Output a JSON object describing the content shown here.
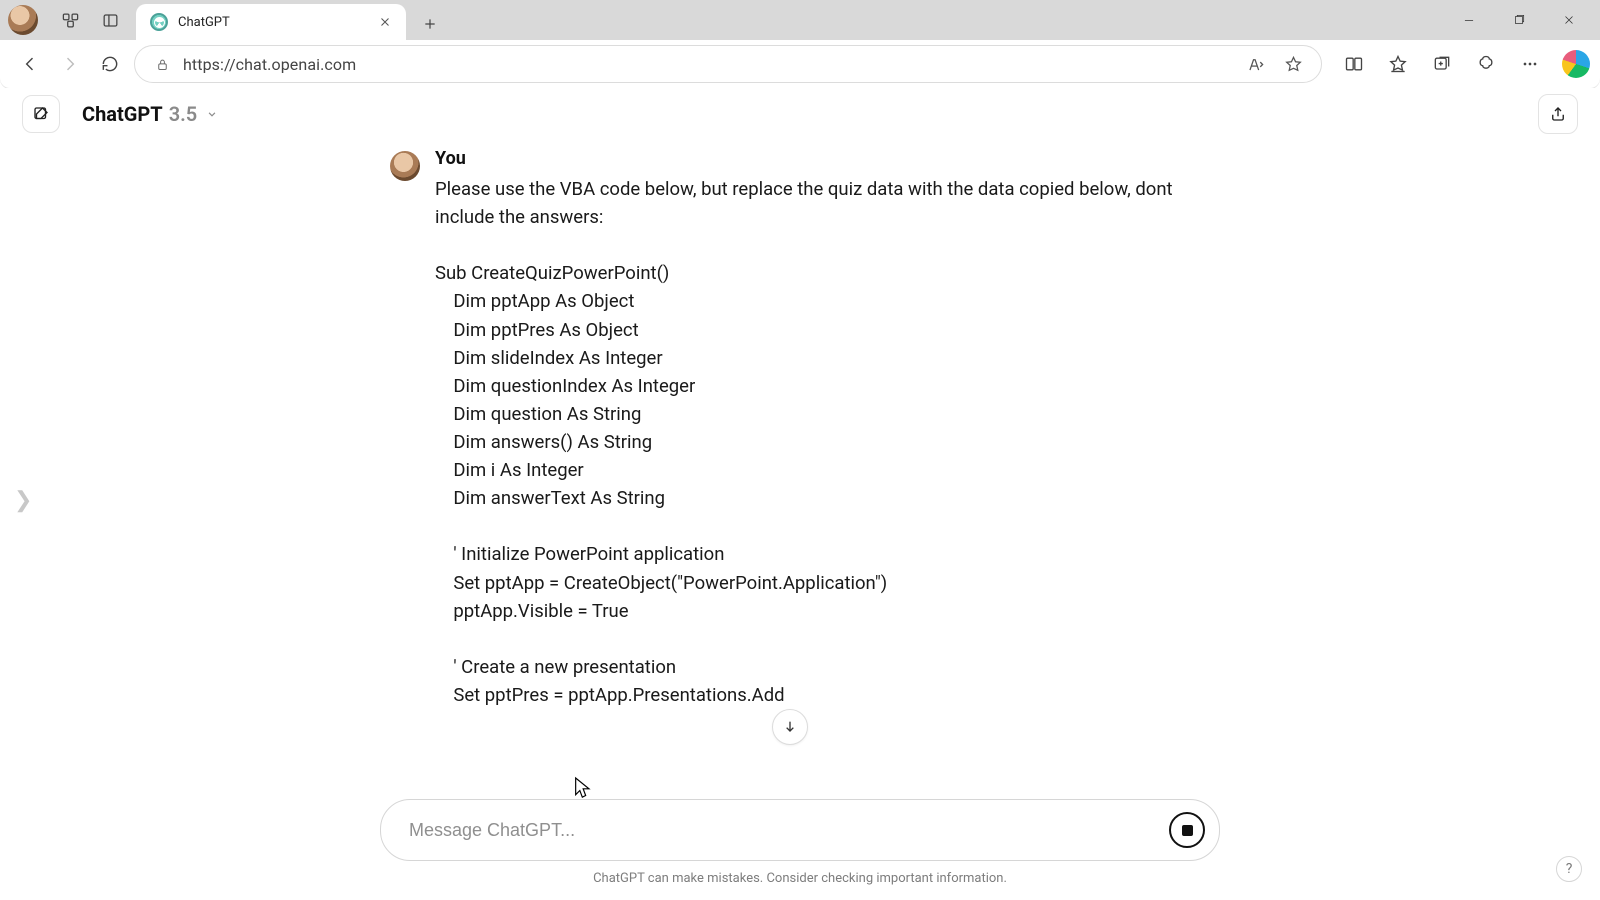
{
  "browser": {
    "tab_title": "ChatGPT",
    "url": "https://chat.openai.com"
  },
  "header": {
    "model_name": "ChatGPT",
    "model_version": "3.5"
  },
  "message": {
    "author": "You",
    "text": "Please use the VBA code below, but replace the quiz data with the data copied below, dont include the answers:\n\nSub CreateQuizPowerPoint()\n    Dim pptApp As Object\n    Dim pptPres As Object\n    Dim slideIndex As Integer\n    Dim questionIndex As Integer\n    Dim question As String\n    Dim answers() As String\n    Dim i As Integer\n    Dim answerText As String\n\n    ' Initialize PowerPoint application\n    Set pptApp = CreateObject(\"PowerPoint.Application\")\n    pptApp.Visible = True\n\n    ' Create a new presentation\n    Set pptPres = pptApp.Presentations.Add"
  },
  "composer": {
    "placeholder": "Message ChatGPT..."
  },
  "footer": {
    "disclaimer": "ChatGPT can make mistakes. Consider checking important information."
  },
  "help_button_label": "?"
}
